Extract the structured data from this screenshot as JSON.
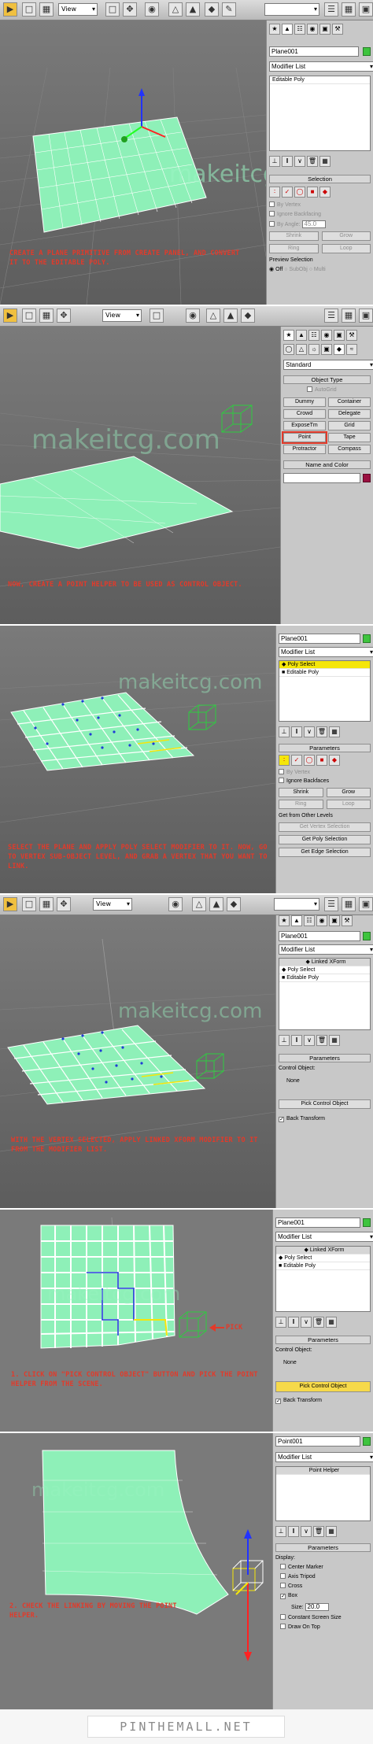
{
  "toolbar": {
    "view_dropdown": "View"
  },
  "steps": [
    {
      "caption": "Create a plane primitive from create panel, and convert it to the editable poly.",
      "panel": {
        "object_name": "Plane001",
        "modifier_list": "Modifier List",
        "stack": [
          "Editable Poly"
        ],
        "rollout": "Selection",
        "by_vertex": "By Vertex",
        "ignore_backfacing": "Ignore Backfacing",
        "by_angle": "By Angle:",
        "by_angle_value": "45.0",
        "shrink": "Shrink",
        "grow": "Grow",
        "ring": "Ring",
        "loop": "Loop",
        "preview_selection": "Preview Selection",
        "off": "Off",
        "subobj": "SubObj",
        "multi": "Multi"
      }
    },
    {
      "caption": "Now, create a point helper to be used as control object.",
      "panel": {
        "category": "Standard",
        "rollout": "Object Type",
        "autogrid": "AutoGrid",
        "buttons": [
          "Dummy",
          "Container",
          "Crowd",
          "Delegate",
          "ExposeTm",
          "Grid",
          "Point",
          "Tape",
          "Protractor",
          "Compass"
        ],
        "name_color": "Name and Color"
      }
    },
    {
      "caption": "Select the plane and apply poly select modifier to it. Now, go to vertex sub-object level, and grab a vertex that you want to link.",
      "panel": {
        "object_name": "Plane001",
        "modifier_list": "Modifier List",
        "stack": [
          "Poly Select",
          "Editable Poly"
        ],
        "rollout": "Parameters",
        "by_vertex": "By Vertex",
        "ignore_backfaces": "Ignore Backfaces",
        "shrink": "Shrink",
        "grow": "Grow",
        "ring": "Ring",
        "loop": "Loop",
        "get_from_other": "Get from Other Levels",
        "get_vertex": "Get Vertex Selection",
        "get_poly": "Get Poly Selection",
        "get_edge": "Get Edge Selection"
      }
    },
    {
      "caption": "With the vertex selected, apply linked xform modifier to it from the modifier list.",
      "panel": {
        "object_name": "Plane001",
        "modifier_list": "Modifier List",
        "stack": [
          "Linked XForm",
          "Poly Select",
          "Editable Poly"
        ],
        "rollout": "Parameters",
        "control_object": "Control Object:",
        "none": "None",
        "pick": "Pick Control Object",
        "back_transform": "Back Transform"
      }
    },
    {
      "caption": "1. Click on \"pick control object\" button and pick the point helper from the scene.",
      "pick_label": "Pick",
      "panel": {
        "object_name": "Plane001",
        "modifier_list": "Modifier List",
        "stack": [
          "Linked XForm",
          "Poly Select",
          "Editable Poly"
        ],
        "rollout": "Parameters",
        "control_object": "Control Object:",
        "none": "None",
        "pick": "Pick Control Object",
        "back_transform": "Back Transform"
      }
    },
    {
      "caption": "2. Check the linking by moving the point helper.",
      "panel": {
        "object_name": "Point001",
        "modifier_list": "Modifier List",
        "stack": [
          "Point Helper"
        ],
        "rollout": "Parameters",
        "display": "Display:",
        "center_marker": "Center Marker",
        "axis_tripod": "Axis Tripod",
        "cross": "Cross",
        "box": "Box",
        "size": "Size:",
        "size_value": "20.0",
        "constant_screen": "Constant Screen Size",
        "draw_on_top": "Draw On Top"
      }
    }
  ],
  "watermark": "makeitcg.com",
  "footer": "PINTHEMALL.NET",
  "colors": {
    "plane": "#8ef0b8",
    "caption": "#e23a2a",
    "highlight": "#f5e60a",
    "helper": "#2ecc40"
  }
}
